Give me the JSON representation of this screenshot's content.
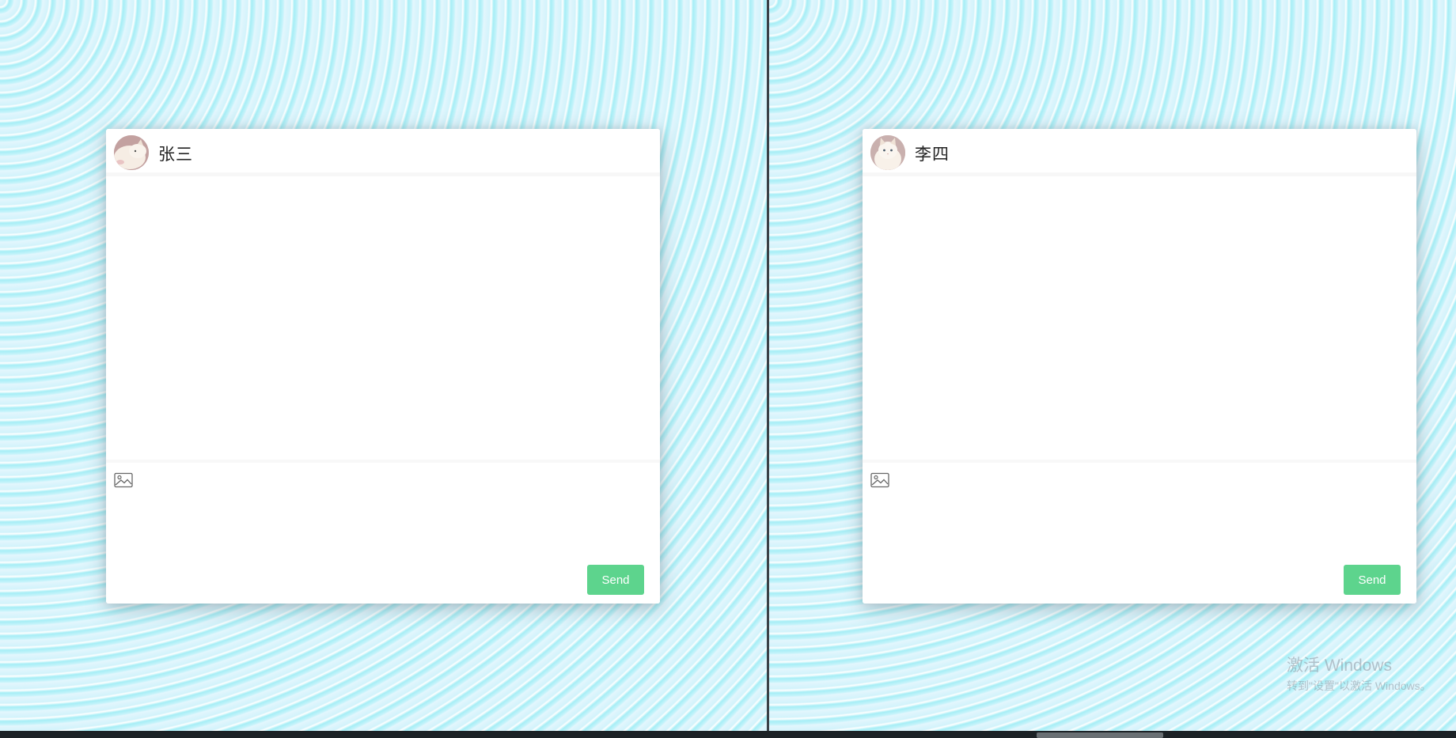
{
  "left_chat": {
    "contact_name": "张三",
    "avatar_icon": "cat-avatar-icon",
    "image_upload_icon": "image-icon",
    "message_input_value": "",
    "send_label": "Send"
  },
  "right_chat": {
    "contact_name": "李四",
    "avatar_icon": "cat-avatar-icon",
    "image_upload_icon": "image-icon",
    "message_input_value": "",
    "send_label": "Send"
  },
  "watermark": {
    "title": "激活 Windows",
    "subtitle": "转到\"设置\"以激活 Windows。"
  },
  "colors": {
    "send_button": "#5dd48d",
    "background_light": "#e3f6fd",
    "background_cyan": "#a6eef6",
    "card": "#ffffff"
  }
}
